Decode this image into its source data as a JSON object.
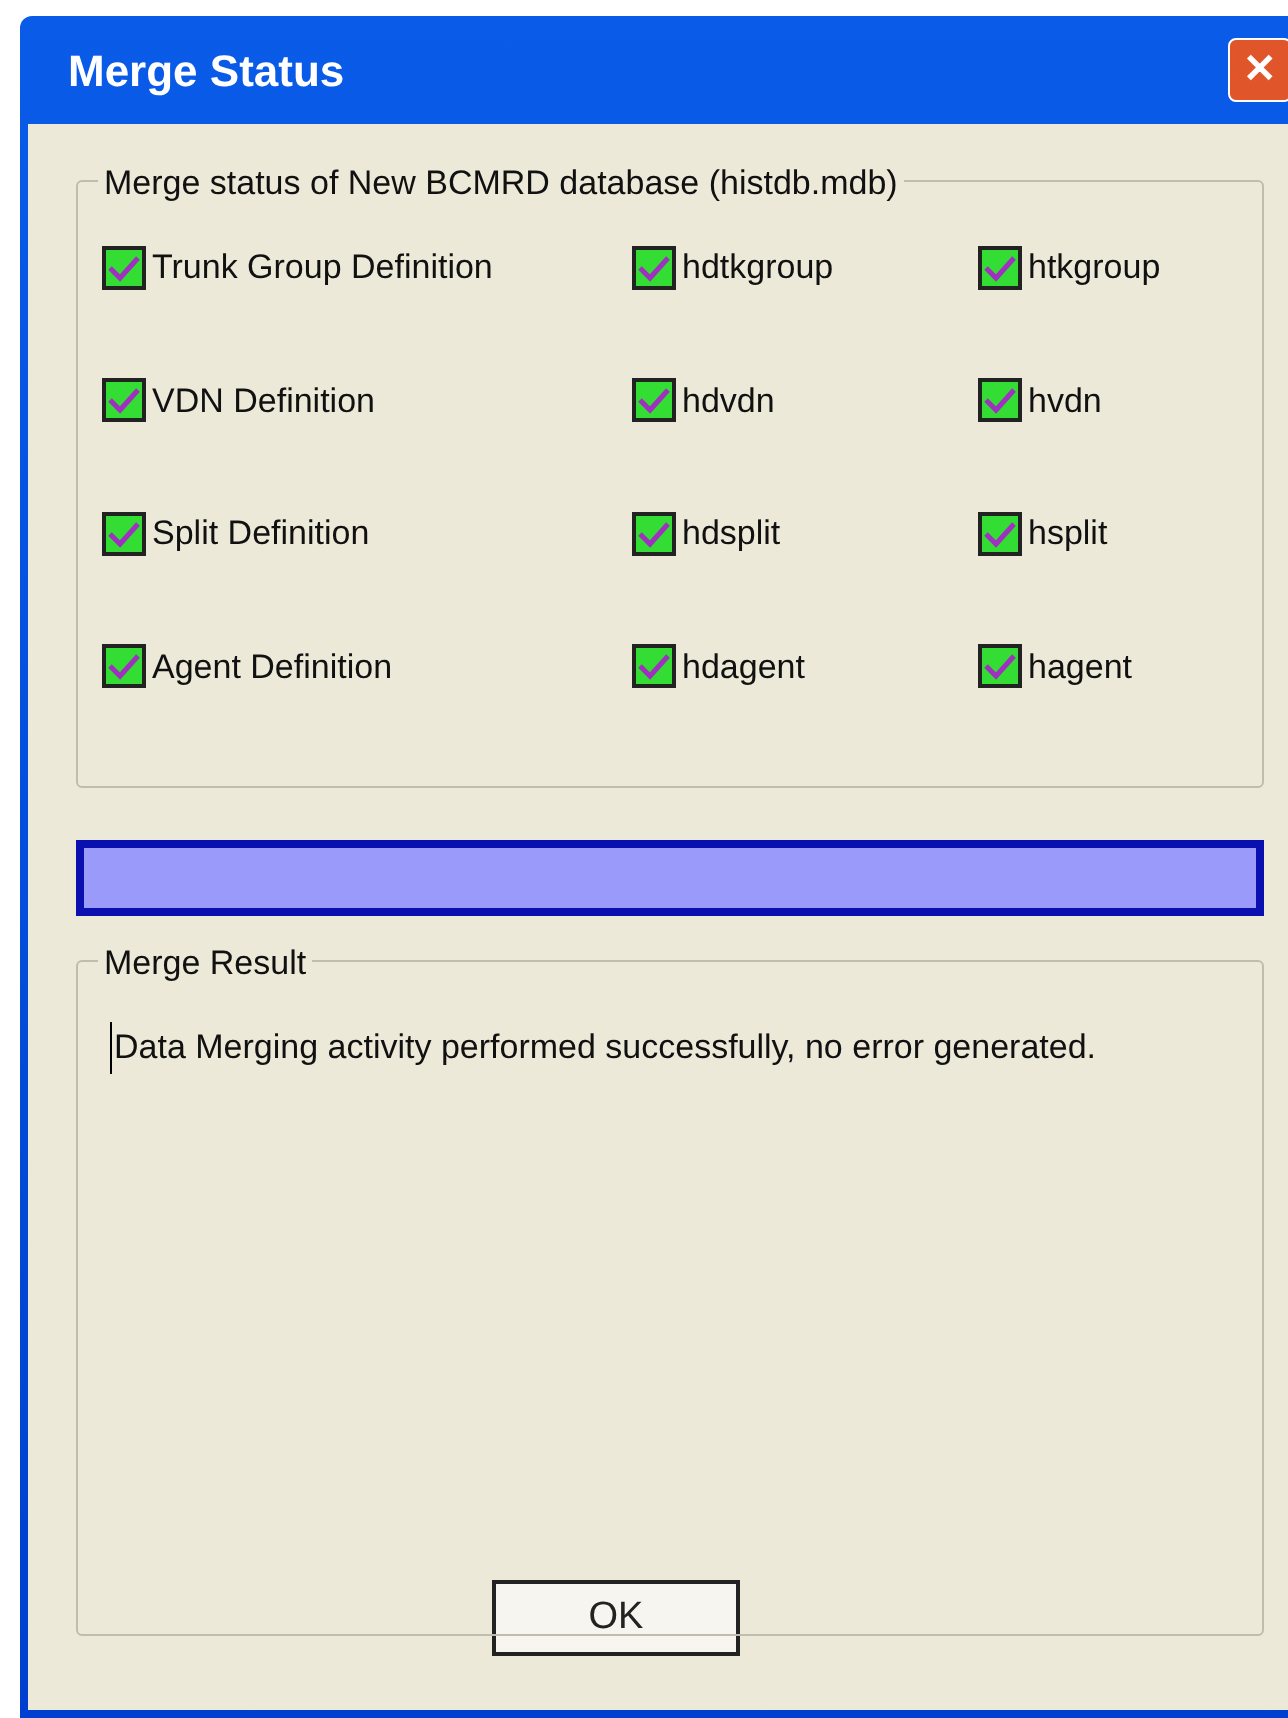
{
  "window": {
    "title": "Merge Status",
    "close_label": "✕"
  },
  "status_group": {
    "title": "Merge status of New BCMRD database (histdb.mdb)",
    "rows": [
      [
        {
          "label": "Trunk Group Definition",
          "checked": true
        },
        {
          "label": "hdtkgroup",
          "checked": true
        },
        {
          "label": "htkgroup",
          "checked": true
        }
      ],
      [
        {
          "label": "VDN Definition",
          "checked": true
        },
        {
          "label": "hdvdn",
          "checked": true
        },
        {
          "label": "hvdn",
          "checked": true
        }
      ],
      [
        {
          "label": "Split Definition",
          "checked": true
        },
        {
          "label": "hdsplit",
          "checked": true
        },
        {
          "label": "hsplit",
          "checked": true
        }
      ],
      [
        {
          "label": "Agent Definition",
          "checked": true
        },
        {
          "label": "hdagent",
          "checked": true
        },
        {
          "label": "hagent",
          "checked": true
        }
      ]
    ]
  },
  "progress": {
    "level": 1
  },
  "result_group": {
    "title": "Merge Result",
    "text": "Data Merging activity performed successfully, no error generated."
  },
  "buttons": [
    "OK"
  ]
}
